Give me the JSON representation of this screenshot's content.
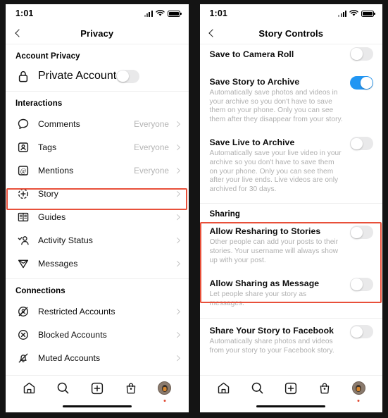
{
  "left_phone": {
    "status_bar": {
      "time": "1:01",
      "signal_icon": "cellular-signal-icon",
      "wifi_icon": "wifi-icon",
      "battery_icon": "battery-full-icon"
    },
    "nav": {
      "back_icon": "chevron-left-icon",
      "title": "Privacy"
    },
    "sections": [
      {
        "heading": "Account Privacy",
        "type": "toggle-list",
        "items": [
          {
            "icon": "lock-icon",
            "label": "Private Account",
            "toggle": "off"
          }
        ]
      },
      {
        "heading": "Interactions",
        "type": "nav-list",
        "items": [
          {
            "icon": "comment-bubble-icon",
            "label": "Comments",
            "value": "Everyone",
            "chevron": "chevron-right-icon"
          },
          {
            "icon": "tag-person-icon",
            "label": "Tags",
            "value": "Everyone",
            "chevron": "chevron-right-icon"
          },
          {
            "icon": "mention-at-icon",
            "label": "Mentions",
            "value": "Everyone",
            "chevron": "chevron-right-icon"
          },
          {
            "icon": "story-plus-icon",
            "label": "Story",
            "value": "",
            "chevron": "chevron-right-icon",
            "highlighted": true
          },
          {
            "icon": "guides-book-icon",
            "label": "Guides",
            "value": "",
            "chevron": "chevron-right-icon"
          },
          {
            "icon": "activity-status-icon",
            "label": "Activity Status",
            "value": "",
            "chevron": "chevron-right-icon"
          },
          {
            "icon": "messages-paperplane-icon",
            "label": "Messages",
            "value": "",
            "chevron": "chevron-right-icon"
          }
        ]
      },
      {
        "heading": "Connections",
        "type": "nav-list",
        "items": [
          {
            "icon": "restricted-accounts-icon",
            "label": "Restricted Accounts",
            "value": "",
            "chevron": "chevron-right-icon"
          },
          {
            "icon": "blocked-accounts-icon",
            "label": "Blocked Accounts",
            "value": "",
            "chevron": "chevron-right-icon"
          },
          {
            "icon": "muted-accounts-icon",
            "label": "Muted Accounts",
            "value": "",
            "chevron": "chevron-right-icon"
          }
        ]
      }
    ],
    "tabbar": [
      {
        "icon": "home-icon",
        "label": "Home"
      },
      {
        "icon": "search-icon",
        "label": "Search"
      },
      {
        "icon": "add-post-icon",
        "label": "Create"
      },
      {
        "icon": "shop-bag-icon",
        "label": "Shop"
      },
      {
        "icon": "profile-avatar-icon",
        "label": "Profile"
      }
    ]
  },
  "right_phone": {
    "status_bar": {
      "time": "1:01",
      "signal_icon": "cellular-signal-icon",
      "wifi_icon": "wifi-icon",
      "battery_icon": "battery-full-icon"
    },
    "nav": {
      "back_icon": "chevron-left-icon",
      "title": "Story Controls"
    },
    "settings": [
      {
        "title": "Save to Camera Roll",
        "description": "",
        "toggle": "off",
        "clipped_top": true
      },
      {
        "title": "Save Story to Archive",
        "description": "Automatically save photos and videos in your archive so you don't have to save them on your phone. Only you can see them after they disappear from your story.",
        "toggle": "on"
      },
      {
        "title": "Save Live to Archive",
        "description": "Automatically save your live video in your archive so you don't have to save them on your phone. Only you can see them after your live ends. Live videos are only archived for 30 days.",
        "toggle": "off"
      }
    ],
    "sharing_heading": "Sharing",
    "sharing_settings": [
      {
        "title": "Allow Resharing to Stories",
        "description": "Other people can add your posts to their stories. Your username will always show up with your post.",
        "toggle": "off",
        "highlighted": true
      },
      {
        "title": "Allow Sharing as Message",
        "description": "Let people share your story as messages.",
        "toggle": "off",
        "highlighted": true
      }
    ],
    "facebook_setting": {
      "title": "Share Your Story to Facebook",
      "description": "Automatically share photos and videos from your story to your Facebook story.",
      "toggle": "off"
    },
    "tabbar": [
      {
        "icon": "home-icon",
        "label": "Home"
      },
      {
        "icon": "search-icon",
        "label": "Search"
      },
      {
        "icon": "add-post-icon",
        "label": "Create"
      },
      {
        "icon": "shop-bag-icon",
        "label": "Shop"
      },
      {
        "icon": "profile-avatar-icon",
        "label": "Profile"
      }
    ]
  },
  "colors": {
    "toggle_on": "#2196f3",
    "toggle_off": "#e9e9ea",
    "highlight_border": "#e8503a",
    "text_primary": "#0d0d0d",
    "text_secondary": "#b0b0b0"
  }
}
